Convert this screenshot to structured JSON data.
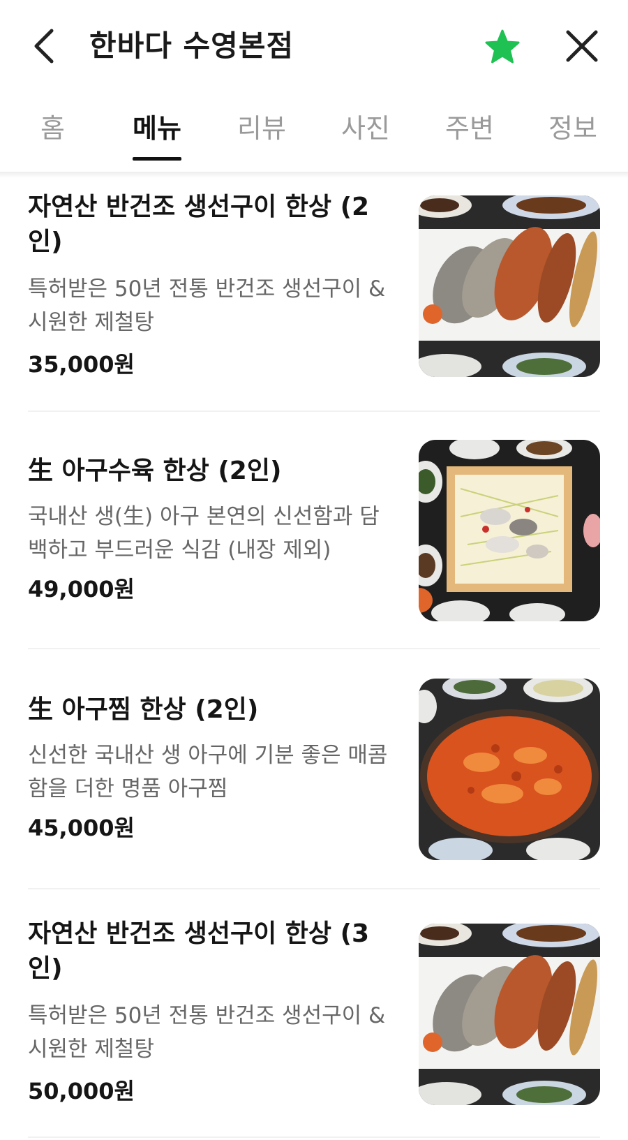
{
  "header": {
    "title": "한바다 수영본점",
    "back_icon": "chevron-left-icon",
    "favorite_icon": "star-icon",
    "close_icon": "close-icon",
    "accent_color": "#1fc153"
  },
  "tabs": [
    {
      "label": "홈",
      "active": false
    },
    {
      "label": "메뉴",
      "active": true
    },
    {
      "label": "리뷰",
      "active": false
    },
    {
      "label": "사진",
      "active": false
    },
    {
      "label": "주변",
      "active": false
    },
    {
      "label": "정보",
      "active": false
    }
  ],
  "menu": [
    {
      "name": "자연산 반건조 생선구이 한상 (2인)",
      "desc": "특허받은 50년 전통 반건조 생선구이 & 시원한 제철탕",
      "price": "35,000원",
      "image": "grilled-fish-photo"
    },
    {
      "name": "生 아구수육 한상 (2인)",
      "desc": "국내산 생(生) 아구 본연의 신선함과 담백하고 부드러운 식감 (내장 제외)",
      "price": "49,000원",
      "image": "monkfish-suyuk-photo"
    },
    {
      "name": "生 아구찜 한상 (2인)",
      "desc": "신선한 국내산 생 아구에 기분 좋은 매콤함을 더한 명품 아구찜",
      "price": "45,000원",
      "image": "braised-monkfish-photo"
    },
    {
      "name": "자연산 반건조 생선구이 한상 (3인)",
      "desc": "특허받은 50년 전통 반건조 생선구이 & 시원한 제철탕",
      "price": "50,000원",
      "image": "grilled-fish-photo"
    }
  ]
}
